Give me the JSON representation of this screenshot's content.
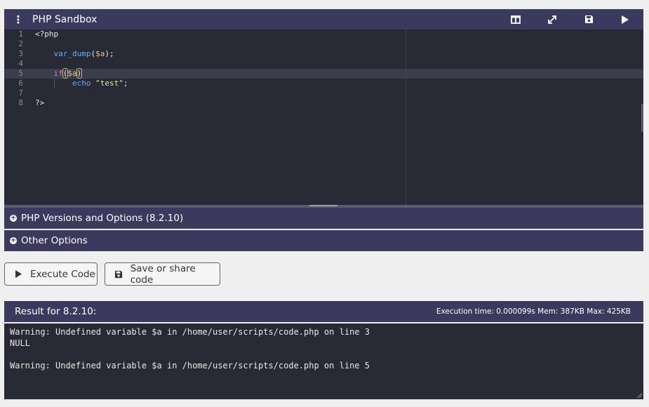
{
  "header": {
    "title": "PHP Sandbox",
    "tools": [
      "split-view-icon",
      "expand-icon",
      "save-icon",
      "play-icon"
    ]
  },
  "editor": {
    "lines": [
      {
        "n": "1",
        "text": "<?php"
      },
      {
        "n": "2",
        "text": ""
      },
      {
        "n": "3",
        "text": "    var_dump($a);"
      },
      {
        "n": "4",
        "text": ""
      },
      {
        "n": "5",
        "text": "    if($a)"
      },
      {
        "n": "6",
        "text": "        echo \"test\";"
      },
      {
        "n": "7",
        "text": ""
      },
      {
        "n": "8",
        "text": "?>"
      }
    ],
    "active_line": 5
  },
  "accordions": {
    "versions": "PHP Versions and Options (8.2.10)",
    "other": "Other Options"
  },
  "buttons": {
    "execute": "Execute Code",
    "save_share": "Save or share code"
  },
  "result": {
    "title": "Result for 8.2.10:",
    "stats": "Execution time: 0.000099s Mem: 387KB Max: 425KB",
    "output": [
      "Warning: Undefined variable $a in /home/user/scripts/code.php on line 3",
      "NULL",
      "",
      "Warning: Undefined variable $a in /home/user/scripts/code.php on line 5"
    ]
  },
  "colors": {
    "panel": "#3b3a5c",
    "editor_bg": "#272935"
  }
}
